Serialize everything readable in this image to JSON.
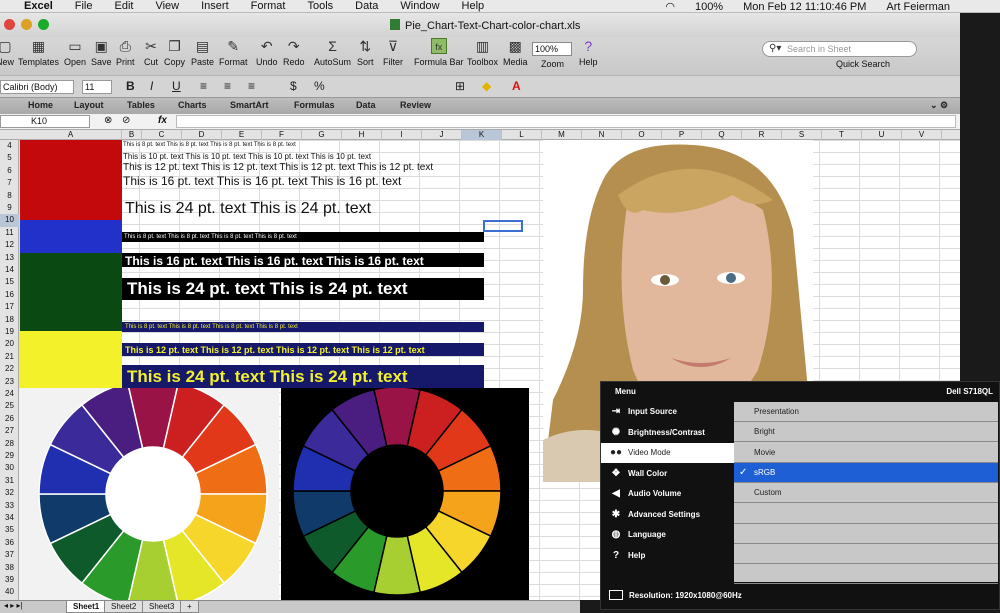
{
  "menubar": {
    "app": "Excel",
    "items": [
      "File",
      "Edit",
      "View",
      "Insert",
      "Format",
      "Tools",
      "Data",
      "Window",
      "Help"
    ],
    "battery": "100%",
    "clock": "Mon Feb 12  11:10:46 PM",
    "user": "Art Feierman"
  },
  "window": {
    "title": "Pie_Chart-Text-Chart-color-chart.xls"
  },
  "toolbar": {
    "buttons": [
      "New",
      "Templates",
      "Open",
      "Save",
      "Print",
      "Cut",
      "Copy",
      "Paste",
      "Format",
      "Undo",
      "Redo",
      "AutoSum",
      "Sort",
      "Filter",
      "Formula Bar",
      "Toolbox",
      "Media",
      "Zoom",
      "Help"
    ],
    "zoom": "100%",
    "search_placeholder": "Search in Sheet",
    "quick_search": "Quick Search"
  },
  "formatbar": {
    "font": "Calibri (Body)",
    "size": "11",
    "bold": "B",
    "italic": "I",
    "underline": "U",
    "currency": "$",
    "percent": "%"
  },
  "ribbon": {
    "tabs": [
      "Home",
      "Layout",
      "Tables",
      "Charts",
      "SmartArt",
      "Formulas",
      "Data",
      "Review"
    ]
  },
  "formula": {
    "cell": "K10",
    "fx": "fx"
  },
  "grid": {
    "columns": [
      "A",
      "B",
      "C",
      "D",
      "E",
      "F",
      "G",
      "H",
      "I",
      "J",
      "K",
      "L",
      "M",
      "N",
      "O",
      "P",
      "Q",
      "R",
      "S",
      "T",
      "U",
      "V"
    ],
    "rows": [
      "4",
      "5",
      "6",
      "7",
      "8",
      "9",
      "10",
      "11",
      "12",
      "13",
      "14",
      "15",
      "16",
      "17",
      "18",
      "19",
      "20",
      "21",
      "22",
      "23",
      "24",
      "25",
      "26",
      "27",
      "28",
      "29",
      "30",
      "31",
      "32",
      "33",
      "34",
      "35",
      "36",
      "37",
      "38",
      "39",
      "40"
    ],
    "selected_col": "K",
    "selected_row": "10"
  },
  "swatches": {
    "red": "#c4090d",
    "blue": "#2131c9",
    "green": "#0a4a12",
    "yellow": "#f3f12a"
  },
  "text_rows": {
    "pt8": "This is 8 pt. text   This is 8 pt. text   This is 8 pt. text   This is 8 pt. text",
    "pt10": "This is 10 pt. text   This is 10 pt. text   This is 10 pt. text   This is 10 pt. text",
    "pt12": "This is 12 pt. text   This is 12 pt. text   This is 12 pt. text   This is 12 pt. text",
    "pt16": "This is 16 pt. text   This is 16 pt. text   This is 16 pt. text",
    "pt24": "This is 24 pt. text   This is 24 pt. text",
    "black8": "This is 8 pt. text   This is 8 pt. text   This is 8 pt. text   This is 8 pt. text",
    "black16": "This is 16 pt. text   This is 16 pt. text   This is 16 pt. text",
    "black24": "This is 24 pt. text   This is 24 pt. text",
    "navy8": "This is 8 pt. text   This is 8 pt. text   This is 8 pt. text   This is 8 pt. text",
    "navy12": "This is 12 pt. text   This is 12 pt. text   This is 12 pt. text   This is 12 pt. text",
    "navy24": "This is 24 pt. text   This is 24 pt. text"
  },
  "wheel_colors": [
    "#9a1346",
    "#cc1f1f",
    "#e2381a",
    "#ef6d14",
    "#f5a31a",
    "#f6d62a",
    "#e6e629",
    "#a8cf32",
    "#2a9a2a",
    "#0e5a2a",
    "#0f3a6a",
    "#1f2fb0",
    "#3a2a9a",
    "#4a1e80"
  ],
  "sheet_tabs": [
    "Sheet1",
    "Sheet2",
    "Sheet3",
    "+"
  ],
  "osd": {
    "title": "Menu",
    "model": "Dell S718QL",
    "items": [
      "Input Source",
      "Brightness/Contrast",
      "Video Mode",
      "Wall Color",
      "Audio Volume",
      "Advanced Settings",
      "Language",
      "Help"
    ],
    "icons": [
      "input-icon",
      "brightness-icon",
      "video-mode-icon",
      "wall-color-icon",
      "audio-icon",
      "settings-icon",
      "language-icon",
      "help-icon"
    ],
    "selected_item": "Video Mode",
    "options": [
      "Presentation",
      "Bright",
      "Movie",
      "sRGB",
      "Custom"
    ],
    "selected_option": "sRGB",
    "resolution": "Resolution:  1920x1080@60Hz"
  }
}
